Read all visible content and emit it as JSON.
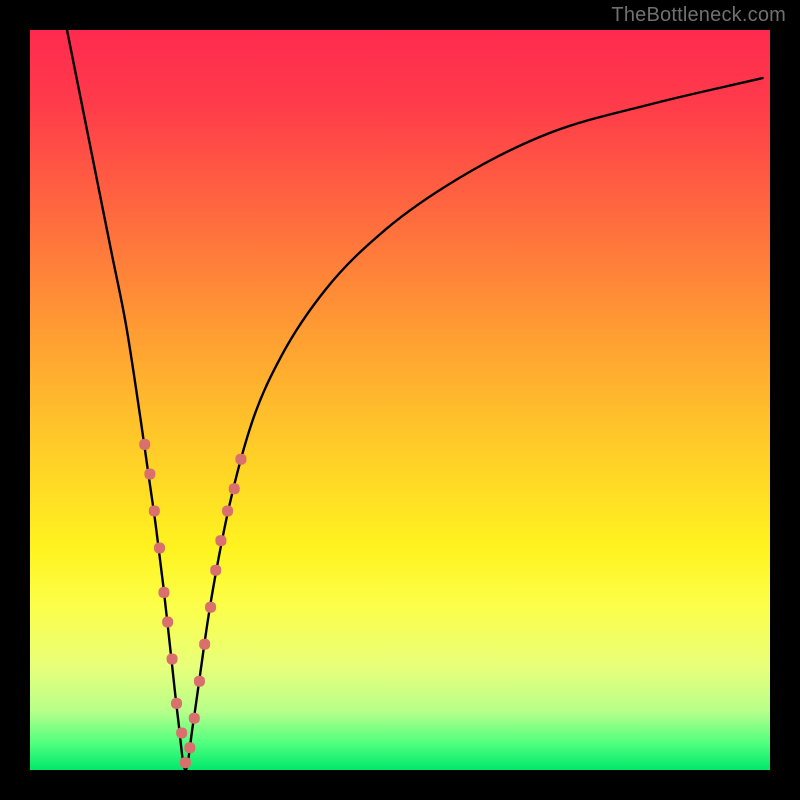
{
  "watermark": "TheBottleneck.com",
  "colors": {
    "frame": "#000000",
    "gradient_stops": [
      {
        "offset": 0.0,
        "color": "#ff2a4f"
      },
      {
        "offset": 0.1,
        "color": "#ff3b4a"
      },
      {
        "offset": 0.25,
        "color": "#ff6a3f"
      },
      {
        "offset": 0.4,
        "color": "#ff9a33"
      },
      {
        "offset": 0.55,
        "color": "#ffc829"
      },
      {
        "offset": 0.7,
        "color": "#fff31f"
      },
      {
        "offset": 0.78,
        "color": "#fcff4a"
      },
      {
        "offset": 0.86,
        "color": "#e8ff7a"
      },
      {
        "offset": 0.92,
        "color": "#b8ff8a"
      },
      {
        "offset": 0.965,
        "color": "#4dff7e"
      },
      {
        "offset": 1.0,
        "color": "#00e86b"
      }
    ],
    "curve": "#000000",
    "markers": "#d9706d"
  },
  "chart_data": {
    "type": "line",
    "title": "",
    "xlabel": "",
    "ylabel": "",
    "xlim": [
      0,
      100
    ],
    "ylim": [
      0,
      100
    ],
    "notch_x": 21,
    "series": [
      {
        "name": "bottleneck-curve",
        "x": [
          5,
          7,
          9,
          11,
          13,
          15,
          16,
          17,
          18,
          19,
          20,
          21,
          22,
          23,
          24,
          25,
          27,
          30,
          34,
          40,
          48,
          58,
          70,
          84,
          99
        ],
        "y": [
          100,
          90,
          80,
          70,
          60,
          47,
          40,
          33,
          25,
          16,
          7,
          0,
          6,
          13,
          20,
          26,
          36,
          47,
          56,
          65,
          73,
          80,
          86,
          90,
          93.5
        ]
      }
    ],
    "markers": {
      "name": "highlight-points",
      "x": [
        15.5,
        16.2,
        16.8,
        17.5,
        18.1,
        18.6,
        19.2,
        19.8,
        20.5,
        21.0,
        21.6,
        22.2,
        22.9,
        23.6,
        24.4,
        25.1,
        25.8,
        26.7,
        27.6,
        28.5
      ],
      "y": [
        44,
        40,
        35,
        30,
        24,
        20,
        15,
        9,
        5,
        1,
        3,
        7,
        12,
        17,
        22,
        27,
        31,
        35,
        38,
        42
      ]
    }
  }
}
